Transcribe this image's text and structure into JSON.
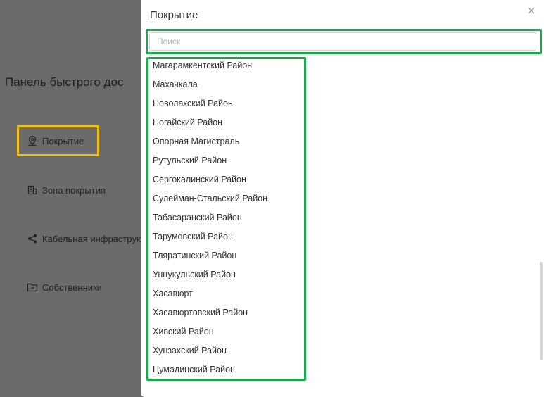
{
  "background_panel": {
    "title": "Панель быстрого дос",
    "items": [
      {
        "label": "Покрытие",
        "icon": "location-pin-icon"
      },
      {
        "label": "Зона покрытия",
        "icon": "building-icon"
      },
      {
        "label": "Кабельная инфраструкт",
        "icon": "share-nodes-icon"
      },
      {
        "label": "Собственники",
        "icon": "folder-icon"
      }
    ]
  },
  "modal": {
    "title": "Покрытие",
    "search": {
      "placeholder": "Поиск",
      "value": ""
    },
    "items": [
      "Магарамкентский Район",
      "Махачкала",
      "Новолакский Район",
      "Ногайский Район",
      "Опорная Магистраль",
      "Рутульский Район",
      "Сергокалинский Район",
      "Сулейман-Стальский Район",
      "Табасаранский Район",
      "Тарумовский Район",
      "Тляратинский Район",
      "Унцукульский Район",
      "Хасавюрт",
      "Хасавюртовский Район",
      "Хивский Район",
      "Хунзахский Район",
      "Цумадинский Район"
    ]
  },
  "colors": {
    "overlay": "#6b6b6b",
    "highlight_yellow": "#f3bd10",
    "highlight_green": "#1aa84b"
  }
}
